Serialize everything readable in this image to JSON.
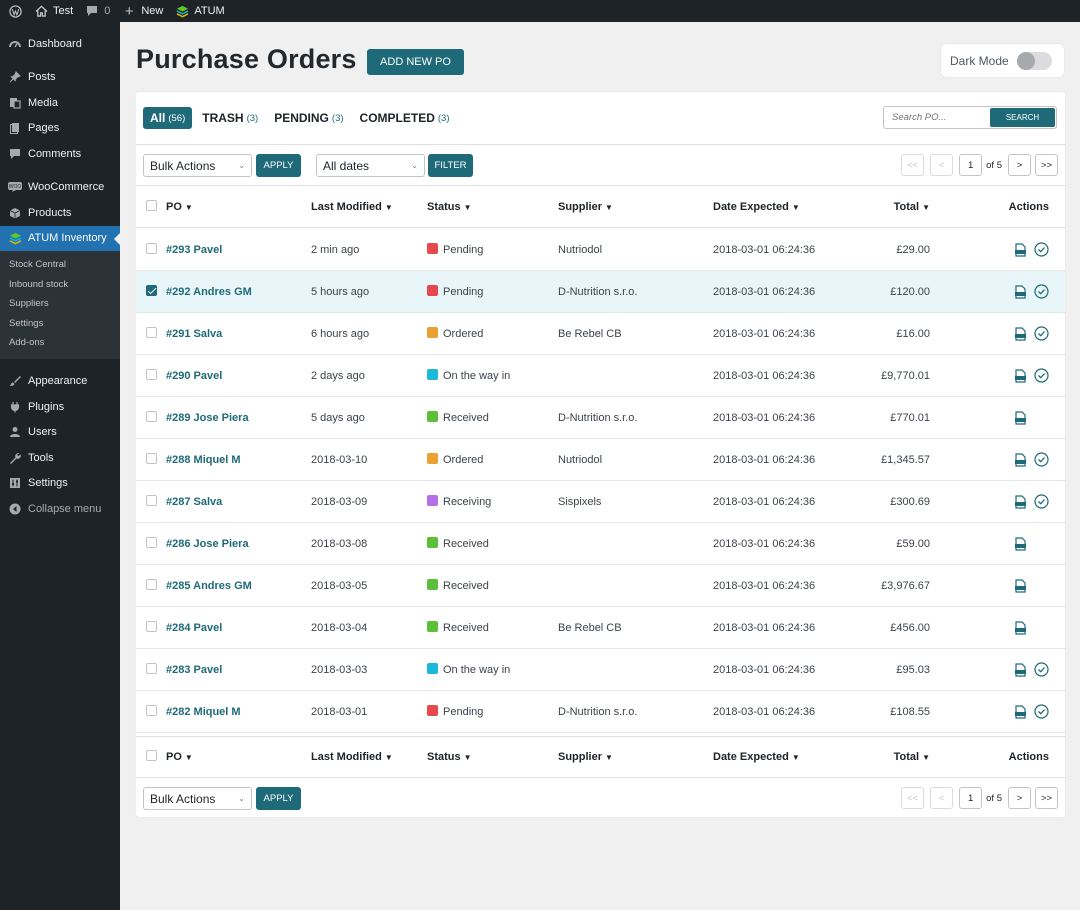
{
  "adminbar": {
    "site_name": "Test",
    "comments_count": "0",
    "new_label": "New",
    "plugin_label": "ATUM"
  },
  "sidebar": {
    "items": [
      {
        "label": "Dashboard",
        "icon": "dashboard-icon"
      },
      {
        "label": "Posts",
        "icon": "pin-icon"
      },
      {
        "label": "Media",
        "icon": "media-icon"
      },
      {
        "label": "Pages",
        "icon": "pages-icon"
      },
      {
        "label": "Comments",
        "icon": "comment-icon"
      },
      {
        "label": "WooCommerce",
        "icon": "woo-icon"
      },
      {
        "label": "Products",
        "icon": "box-icon"
      },
      {
        "label": "ATUM Inventory",
        "icon": "atum-icon"
      },
      {
        "label": "Appearance",
        "icon": "brush-icon"
      },
      {
        "label": "Plugins",
        "icon": "plug-icon"
      },
      {
        "label": "Users",
        "icon": "user-icon"
      },
      {
        "label": "Tools",
        "icon": "wrench-icon"
      },
      {
        "label": "Settings",
        "icon": "settings-icon"
      },
      {
        "label": "Collapse menu",
        "icon": "collapse-icon"
      }
    ],
    "submenu": [
      "Stock Central",
      "Inbound stock",
      "Suppliers",
      "Settings",
      "Add-ons"
    ]
  },
  "page": {
    "title": "Purchase Orders",
    "add_button": "ADD NEW PO",
    "dark_mode_label": "Dark Mode"
  },
  "views": [
    {
      "label": "All",
      "count": "(56)"
    },
    {
      "label": "TRASH",
      "count": "(3)"
    },
    {
      "label": "PENDING",
      "count": "(3)"
    },
    {
      "label": "COMPLETED",
      "count": "(3)"
    }
  ],
  "search": {
    "placeholder": "Search PO...",
    "button": "SEARCH"
  },
  "tablenav": {
    "bulk_actions": "Bulk Actions",
    "apply": "APPLY",
    "dates": "All dates",
    "filter": "FILTER",
    "first": "<<",
    "prev": "<",
    "page": "1",
    "of": "of 5",
    "next": ">",
    "last": ">>"
  },
  "columns": {
    "po": "PO",
    "modified": "Last Modified",
    "status": "Status",
    "supplier": "Supplier",
    "date": "Date Expected",
    "total": "Total",
    "actions": "Actions"
  },
  "status_colors": {
    "Pending": "#e5484d",
    "Ordered": "#eba032",
    "On the way in": "#1bb8d8",
    "Received": "#5bbf3a",
    "Receiving": "#b36ee8"
  },
  "rows": [
    {
      "po": "#293 Pavel",
      "modified": "2 min ago",
      "status": "Pending",
      "supplier": "Nutriodol",
      "date": "2018-03-01 06:24:36",
      "total": "£29.00",
      "checked": false,
      "complete_action": true
    },
    {
      "po": "#292 Andres GM",
      "modified": "5 hours ago",
      "status": "Pending",
      "supplier": "D-Nutrition s.r.o.",
      "date": "2018-03-01 06:24:36",
      "total": "£120.00",
      "checked": true,
      "complete_action": true
    },
    {
      "po": "#291 Salva",
      "modified": "6 hours ago",
      "status": "Ordered",
      "supplier": "Be Rebel CB",
      "date": "2018-03-01 06:24:36",
      "total": "£16.00",
      "checked": false,
      "complete_action": true
    },
    {
      "po": "#290 Pavel",
      "modified": "2 days ago",
      "status": "On the way in",
      "supplier": "",
      "date": "2018-03-01 06:24:36",
      "total": "£9,770.01",
      "checked": false,
      "complete_action": true
    },
    {
      "po": "#289 Jose Piera",
      "modified": "5 days ago",
      "status": "Received",
      "supplier": "D-Nutrition s.r.o.",
      "date": "2018-03-01 06:24:36",
      "total": "£770.01",
      "checked": false,
      "complete_action": false
    },
    {
      "po": "#288 Miquel M",
      "modified": "2018-03-10",
      "status": "Ordered",
      "supplier": "Nutriodol",
      "date": "2018-03-01 06:24:36",
      "total": "£1,345.57",
      "checked": false,
      "complete_action": true
    },
    {
      "po": "#287 Salva",
      "modified": "2018-03-09",
      "status": "Receiving",
      "supplier": "Sispixels",
      "date": "2018-03-01 06:24:36",
      "total": "£300.69",
      "checked": false,
      "complete_action": true
    },
    {
      "po": "#286 Jose Piera",
      "modified": "2018-03-08",
      "status": "Received",
      "supplier": "",
      "date": "2018-03-01 06:24:36",
      "total": "£59.00",
      "checked": false,
      "complete_action": false
    },
    {
      "po": "#285 Andres GM",
      "modified": "2018-03-05",
      "status": "Received",
      "supplier": "",
      "date": "2018-03-01 06:24:36",
      "total": "£3,976.67",
      "checked": false,
      "complete_action": false
    },
    {
      "po": "#284 Pavel",
      "modified": "2018-03-04",
      "status": "Received",
      "supplier": "Be Rebel CB",
      "date": "2018-03-01 06:24:36",
      "total": "£456.00",
      "checked": false,
      "complete_action": false
    },
    {
      "po": "#283 Pavel",
      "modified": "2018-03-03",
      "status": "On the way in",
      "supplier": "",
      "date": "2018-03-01 06:24:36",
      "total": "£95.03",
      "checked": false,
      "complete_action": true
    },
    {
      "po": "#282 Miquel M",
      "modified": "2018-03-01",
      "status": "Pending",
      "supplier": "D-Nutrition s.r.o.",
      "date": "2018-03-01 06:24:36",
      "total": "£108.55",
      "checked": false,
      "complete_action": true
    }
  ]
}
